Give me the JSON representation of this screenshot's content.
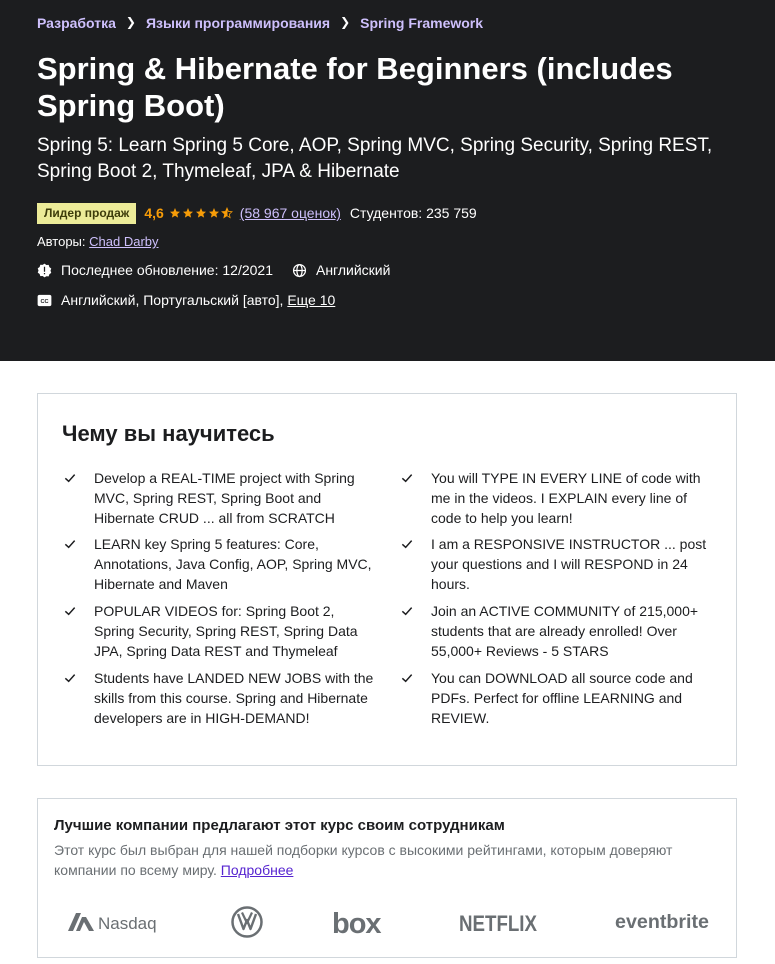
{
  "breadcrumb": [
    "Разработка",
    "Языки программирования",
    "Spring Framework"
  ],
  "course": {
    "title": "Spring & Hibernate for Beginners (includes Spring Boot)",
    "subtitle": "Spring 5: Learn Spring 5 Core, AOP, Spring MVC, Spring Security, Spring REST, Spring Boot 2, Thymeleaf, JPA & Hibernate",
    "badge": "Лидер продаж",
    "rating": "4,6",
    "rating_value": 4.6,
    "rating_count": "(58 967 оценок)",
    "students": "Студентов: 235 759",
    "authors_label": "Авторы:",
    "author": "Chad Darby",
    "last_update": "Последнее обновление: 12/2021",
    "language": "Английский",
    "captions": "Английский, Португальский [авто],",
    "captions_more": "Еще 10"
  },
  "learn": {
    "title": "Чему вы научитесь",
    "items": [
      "Develop a REAL-TIME project with Spring MVC, Spring REST, Spring Boot and Hibernate CRUD ... all from SCRATCH",
      "You will TYPE IN EVERY LINE of code with me in the videos. I EXPLAIN every line of code to help you learn!",
      "LEARN key Spring 5 features: Core, Annotations, Java Config, AOP, Spring MVC, Hibernate and Maven",
      "I am a RESPONSIVE INSTRUCTOR ... post your questions and I will RESPOND in 24 hours.",
      "POPULAR VIDEOS for: Spring Boot 2, Spring Security, Spring REST, Spring Data JPA, Spring Data REST and Thymeleaf",
      "Join an ACTIVE COMMUNITY of 215,000+ students that are already enrolled! Over 55,000+ Reviews - 5 STARS",
      "Students have LANDED NEW JOBS with the skills from this course. Spring and Hibernate developers are in HIGH-DEMAND!",
      "You can DOWNLOAD all source code and PDFs. Perfect for offline LEARNING and REVIEW."
    ]
  },
  "companies": {
    "title": "Лучшие компании предлагают этот курс своим сотрудникам",
    "description": "Этот курс был выбран для нашей подборки курсов с высокими рейтингами, которым доверяют компании по всему миру.",
    "more_link": "Подробнее",
    "logos": [
      "Nasdaq",
      "VW",
      "box",
      "NETFLIX",
      "eventbrite"
    ]
  },
  "colors": {
    "hero_bg": "#1c1d1f",
    "link_purple": "#cec0fc",
    "star_orange": "#f69c08",
    "badge_bg": "#eceb98",
    "logo_gray": "#6a6f73"
  },
  "icons": [
    "chevron-right-icon",
    "star-icon",
    "alert-badge-icon",
    "globe-icon",
    "closed-captions-icon",
    "check-icon"
  ]
}
